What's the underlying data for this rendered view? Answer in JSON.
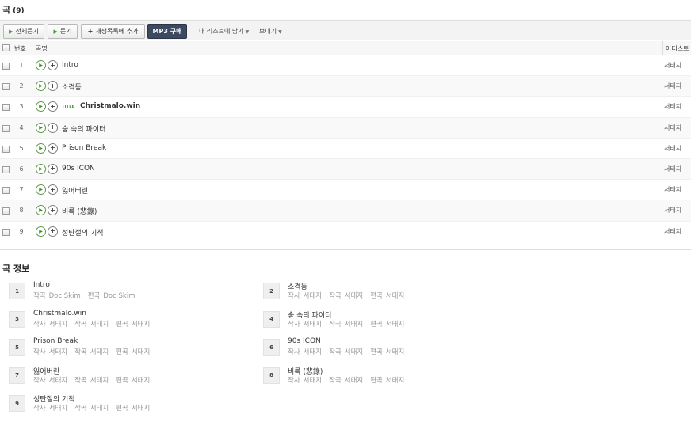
{
  "header": {
    "title": "곡",
    "count": "(9)"
  },
  "toolbar": {
    "play_all": "전체듣기",
    "play": "듣기",
    "add_playlist": "재생목록에 추가",
    "mp3_buy": "MP3 구매",
    "add_mylist": "내 리스트에 담기",
    "send": "보내기"
  },
  "table": {
    "col_num": "번호",
    "col_title": "곡명",
    "col_artist": "아티스트",
    "title_badge": "TITLE",
    "rows": [
      {
        "num": "1",
        "title": "Intro",
        "artist": "서태지"
      },
      {
        "num": "2",
        "title": "소격동",
        "artist": "서태지"
      },
      {
        "num": "3",
        "title": "Christmalo.win",
        "artist": "서태지"
      },
      {
        "num": "4",
        "title": "숲 속의 파이터",
        "artist": "서태지"
      },
      {
        "num": "5",
        "title": "Prison Break",
        "artist": "서태지"
      },
      {
        "num": "6",
        "title": "90s ICON",
        "artist": "서태지"
      },
      {
        "num": "7",
        "title": "잃어버린",
        "artist": "서태지"
      },
      {
        "num": "8",
        "title": "비록 (悲錄)",
        "artist": "서태지"
      },
      {
        "num": "9",
        "title": "성탄절의 기적",
        "artist": "서태지"
      }
    ]
  },
  "info": {
    "title": "곡 정보",
    "items": [
      {
        "num": "1",
        "name": "Intro",
        "credits": [
          "작곡",
          "Doc Skim",
          "편곡",
          "Doc Skim"
        ]
      },
      {
        "num": "2",
        "name": "소격동",
        "credits": [
          "작사",
          "서태지",
          "작곡",
          "서태지",
          "편곡",
          "서태지"
        ]
      },
      {
        "num": "3",
        "name": "Christmalo.win",
        "credits": [
          "작사",
          "서태지",
          "작곡",
          "서태지",
          "편곡",
          "서태지"
        ]
      },
      {
        "num": "4",
        "name": "숲 속의 파이터",
        "credits": [
          "작사",
          "서태지",
          "작곡",
          "서태지",
          "편곡",
          "서태지"
        ]
      },
      {
        "num": "5",
        "name": "Prison Break",
        "credits": [
          "작사",
          "서태지",
          "작곡",
          "서태지",
          "편곡",
          "서태지"
        ]
      },
      {
        "num": "6",
        "name": "90s ICON",
        "credits": [
          "작사",
          "서태지",
          "작곡",
          "서태지",
          "편곡",
          "서태지"
        ]
      },
      {
        "num": "7",
        "name": "잃어버린",
        "credits": [
          "작사",
          "서태지",
          "작곡",
          "서태지",
          "편곡",
          "서태지"
        ]
      },
      {
        "num": "8",
        "name": "비록 (悲錄)",
        "credits": [
          "작사",
          "서태지",
          "작곡",
          "서태지",
          "편곡",
          "서태지"
        ]
      },
      {
        "num": "9",
        "name": "성탄절의 기적",
        "credits": [
          "작사",
          "서태지",
          "작곡",
          "서태지",
          "편곡",
          "서태지"
        ]
      }
    ]
  },
  "colors": {
    "accent_green": "#3aa124",
    "mp3_button": "#3c4960"
  }
}
